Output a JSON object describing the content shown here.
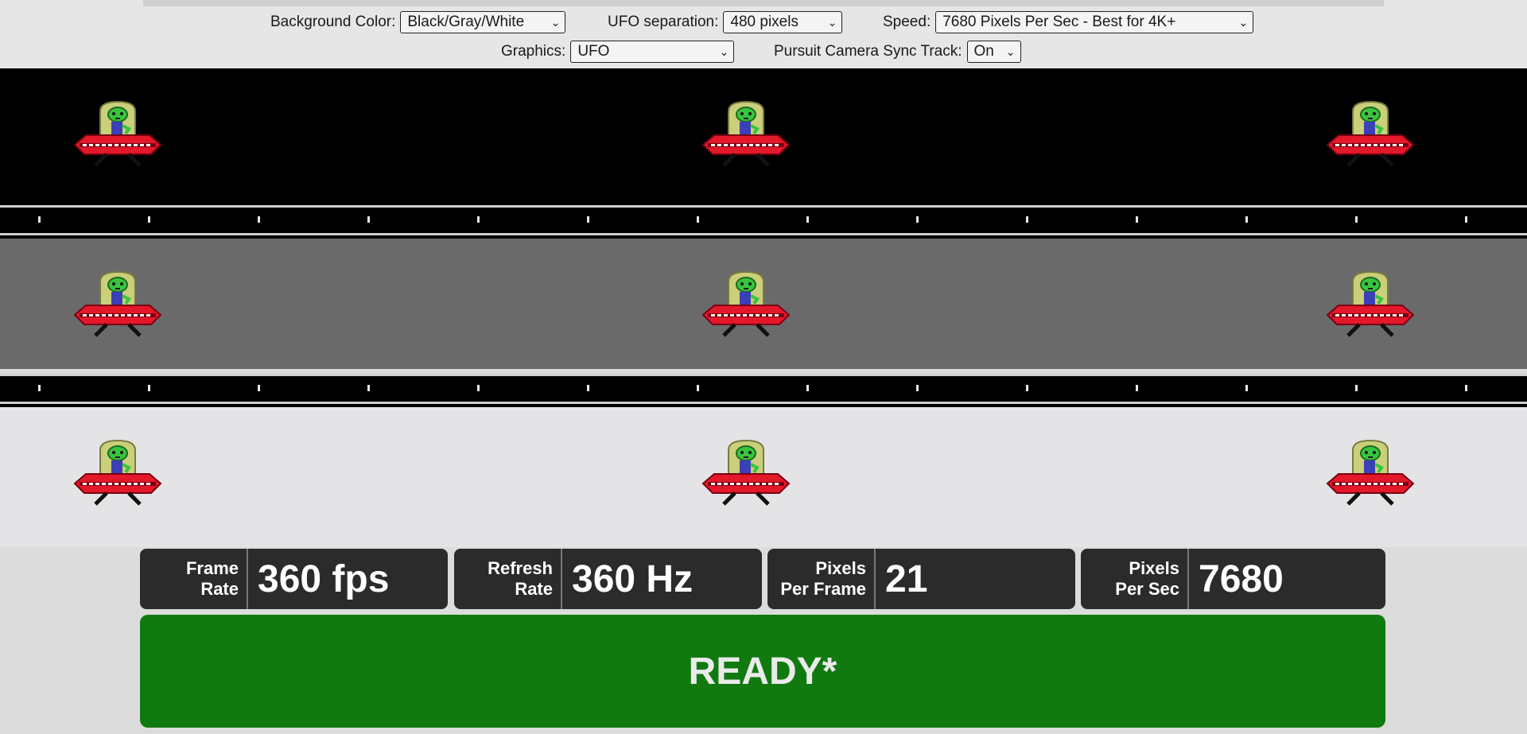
{
  "controls": {
    "background_color": {
      "label": "Background Color:",
      "value": "Black/Gray/White"
    },
    "ufo_separation": {
      "label": "UFO separation:",
      "value": "480 pixels"
    },
    "speed": {
      "label": "Speed:",
      "value": "7680 Pixels Per Sec - Best for 4K+"
    },
    "graphics": {
      "label": "Graphics:",
      "value": "UFO"
    },
    "pursuit_camera": {
      "label": "Pursuit Camera Sync Track:",
      "value": "On"
    }
  },
  "colors": {
    "lane_black": "#000000",
    "lane_gray": "#6a6a6a",
    "lane_white": "#e4e4e6",
    "ready_green": "#107a10",
    "stat_panel": "#2b2b2b"
  },
  "stats": {
    "frame_rate": {
      "label_line1": "Frame",
      "label_line2": "Rate",
      "value": "360 fps"
    },
    "refresh_rate": {
      "label_line1": "Refresh",
      "label_line2": "Rate",
      "value": "360 Hz"
    },
    "pixels_per_frame": {
      "label_line1": "Pixels",
      "label_line2": "Per Frame",
      "value": "21"
    },
    "pixels_per_sec": {
      "label_line1": "Pixels",
      "label_line2": "Per Sec",
      "value": "7680"
    }
  },
  "status": {
    "text": "READY*"
  },
  "icons": [
    "ufo-icon",
    "chevron-down-icon"
  ]
}
